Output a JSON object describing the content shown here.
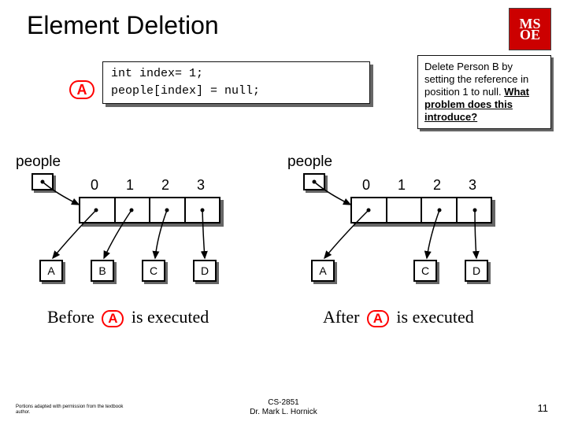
{
  "title": "Element Deletion",
  "logo": "MS\nOE",
  "code": {
    "line1": "int index= 1;",
    "line2": "people[index] = null;"
  },
  "markerA": "A",
  "note": {
    "text_pre": "Delete Person B by setting the reference in position 1 to null. ",
    "question": "What problem does this introduce?"
  },
  "left": {
    "label": "people",
    "idx": [
      "0",
      "1",
      "2",
      "3"
    ],
    "objs": [
      "A",
      "B",
      "C",
      "D"
    ],
    "caption_before": "Before",
    "caption_exec": " is executed"
  },
  "right": {
    "label": "people",
    "idx": [
      "0",
      "1",
      "2",
      "3"
    ],
    "objs": [
      "A",
      "",
      "C",
      "D"
    ],
    "caption_after": "After",
    "caption_exec": " is executed"
  },
  "footer": {
    "left": "Portions adapted with permission from the textbook author.",
    "center_top": "CS-2851",
    "center_bottom": "Dr. Mark L. Hornick",
    "right": "11"
  }
}
